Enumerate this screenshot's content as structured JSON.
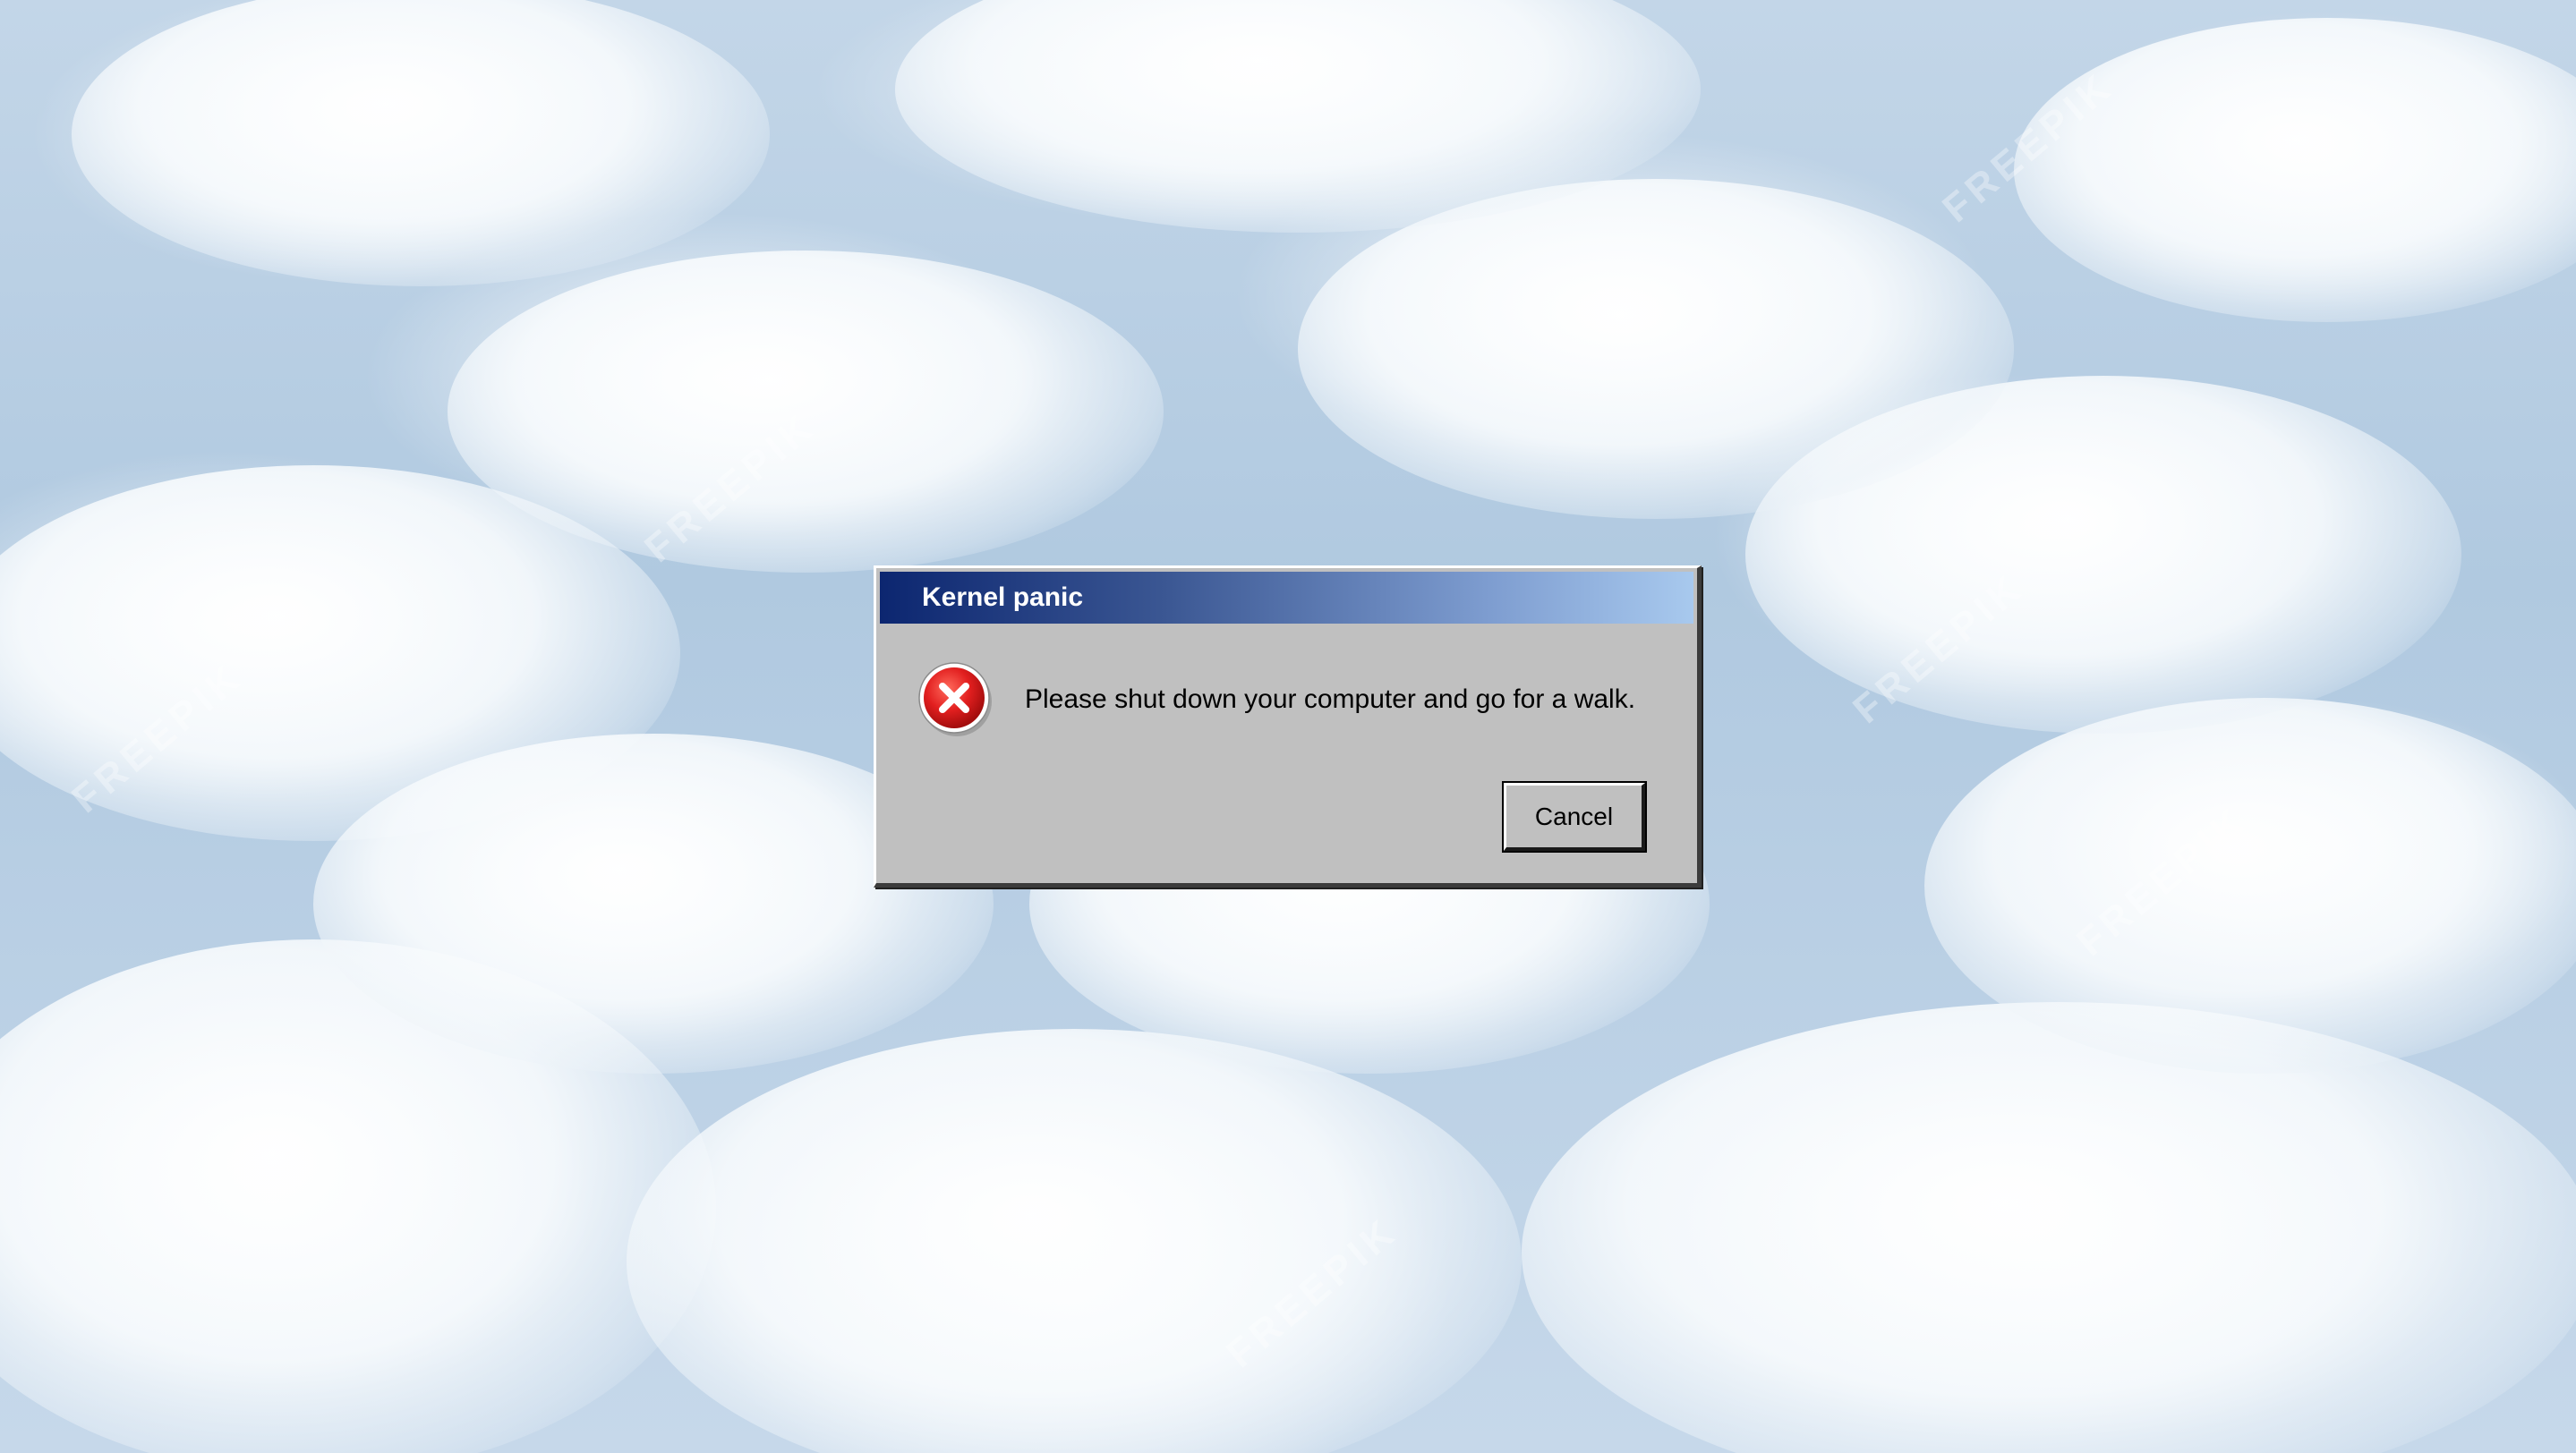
{
  "dialog": {
    "title": "Kernel panic",
    "message": "Please shut down your computer and go for a walk.",
    "icon": "error-icon",
    "cancel_label": "Cancel"
  },
  "colors": {
    "titlebar_start": "#0c2670",
    "titlebar_end": "#a8c9ee",
    "dialog_bg": "#c0c0c0",
    "error_red": "#d81c1c"
  },
  "background": {
    "watermark_text": "FREEPIK"
  }
}
